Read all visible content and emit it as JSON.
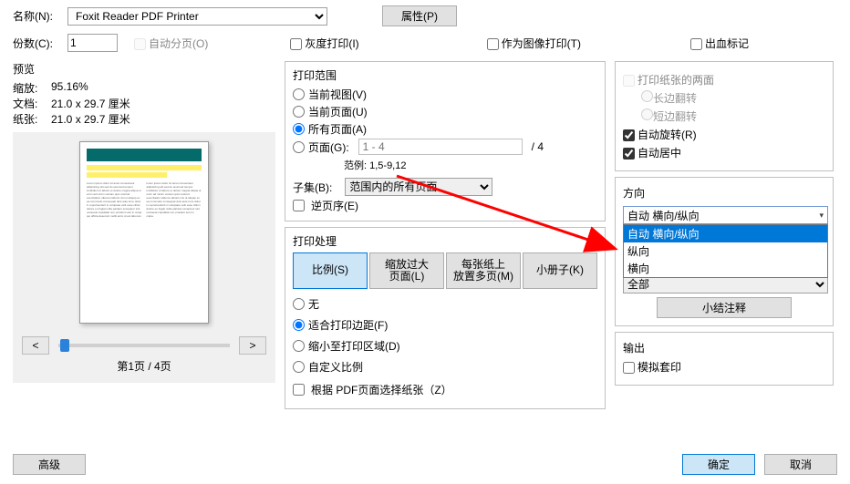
{
  "top": {
    "name_label": "名称(N):",
    "printer_selected": "Foxit Reader PDF Printer",
    "properties_btn": "属性(P)",
    "copies_label": "份数(C):",
    "copies_value": 1,
    "collate": "自动分页(O)",
    "grayscale": "灰度打印(I)",
    "asimage": "作为图像打印(T)",
    "bleed": "出血标记"
  },
  "preview": {
    "title": "预览",
    "zoom_lbl": "缩放:",
    "zoom_v": "95.16%",
    "doc_lbl": "文档:",
    "doc_v": "21.0 x 29.7 厘米",
    "paper_lbl": "纸张:",
    "paper_v": "21.0 x 29.7 厘米",
    "page_info": "第1页 / 4页"
  },
  "range": {
    "title": "打印范围",
    "r1": "当前视图(V)",
    "r2": "当前页面(U)",
    "r3": "所有页面(A)",
    "r4": "页面(G):",
    "total_sep": "/ 4",
    "pages_ph": "1 - 4",
    "example": "范例: 1,5-9,12",
    "subset_lbl": "子集(B):",
    "subset_sel": "范围内的所有页面",
    "reverse": "逆页序(E)"
  },
  "proc": {
    "title": "打印处理",
    "tab1": "比例(S)",
    "tab2a": "缩放过大",
    "tab2b": "页面(L)",
    "tab3a": "每张纸上",
    "tab3b": "放置多页(M)",
    "tab4": "小册子(K)",
    "o1": "无",
    "o2": "适合打印边距(F)",
    "o3": "缩小至打印区域(D)",
    "o4": "自定义比例",
    "pdfsize": "根据 PDF页面选择纸张（Z）"
  },
  "rside": {
    "bothsides": "打印纸张的两面",
    "long": "长边翻转",
    "short": "短边翻转",
    "autorot": "自动旋转(R)",
    "autocenter": "自动居中",
    "ori_title": "方向",
    "ori_sel": "自动 横向/纵向",
    "ori_opts": [
      "自动 横向/纵向",
      "纵向",
      "横向"
    ],
    "print_sel": "全部",
    "annot_btn": "小结注释",
    "out_title": "输出",
    "simulate": "模拟套印"
  },
  "bottom": {
    "adv": "高级",
    "ok": "确定",
    "cancel": "取消"
  }
}
